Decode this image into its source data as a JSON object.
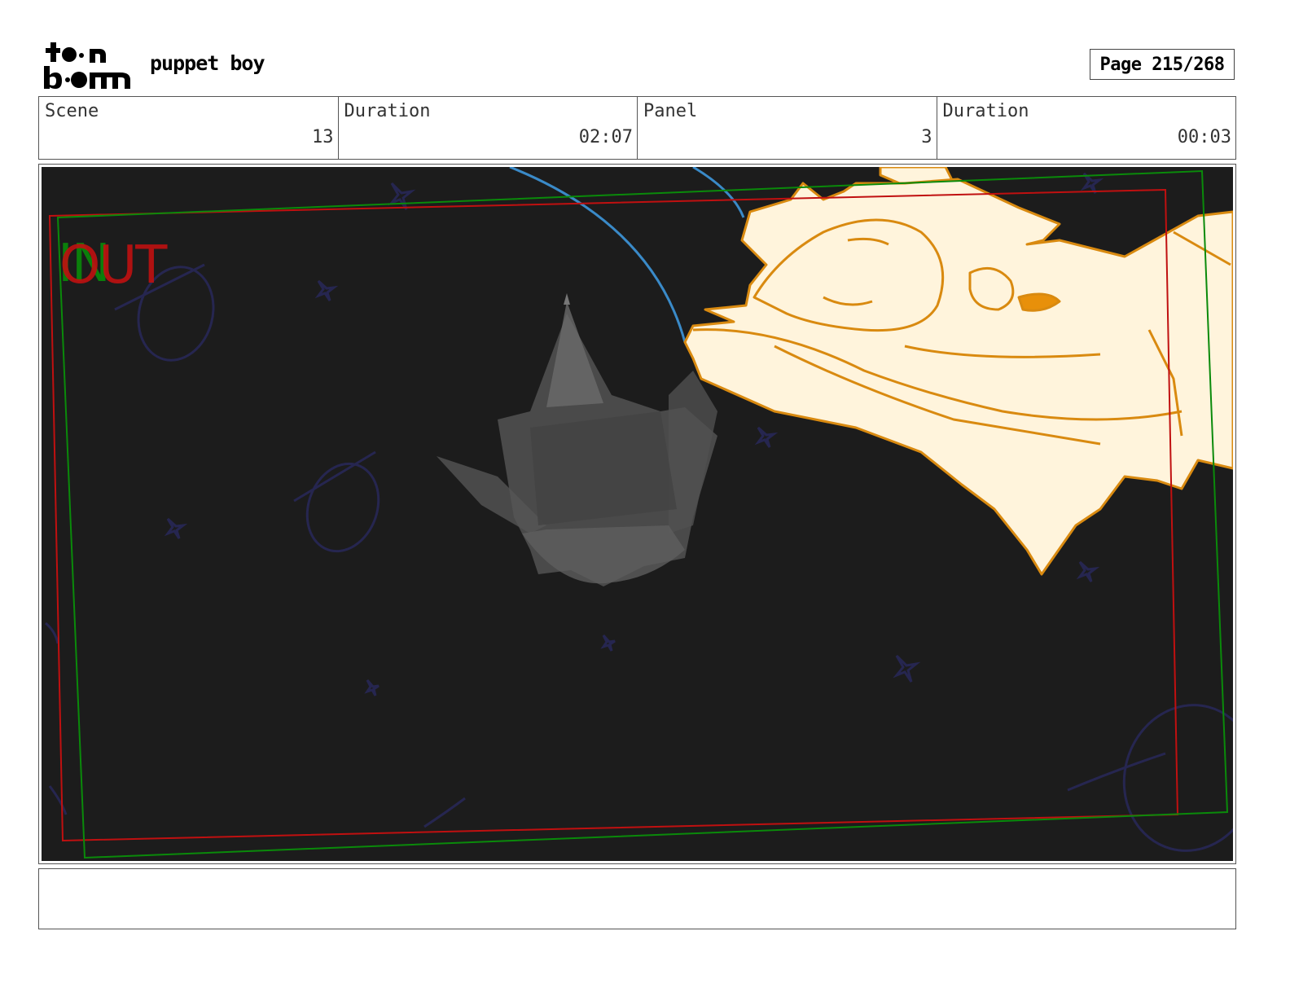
{
  "header": {
    "logo_text": "toon boom",
    "project_title": "puppet boy",
    "page_label": "Page 215/268"
  },
  "info": {
    "scene_label": "Scene",
    "scene_value": "13",
    "scene_duration_label": "Duration",
    "scene_duration_value": "02:07",
    "panel_label": "Panel",
    "panel_value": "3",
    "panel_duration_label": "Duration",
    "panel_duration_value": "00:03"
  },
  "panel": {
    "in_label": "IN",
    "out_label": "OUT",
    "background_color": "#1c1c1c",
    "in_frame_color": "#0a8a0a",
    "out_frame_color": "#c01010",
    "character_fill": "#fff4dc",
    "character_line": "#d98a10"
  },
  "notes": {
    "text": ""
  }
}
